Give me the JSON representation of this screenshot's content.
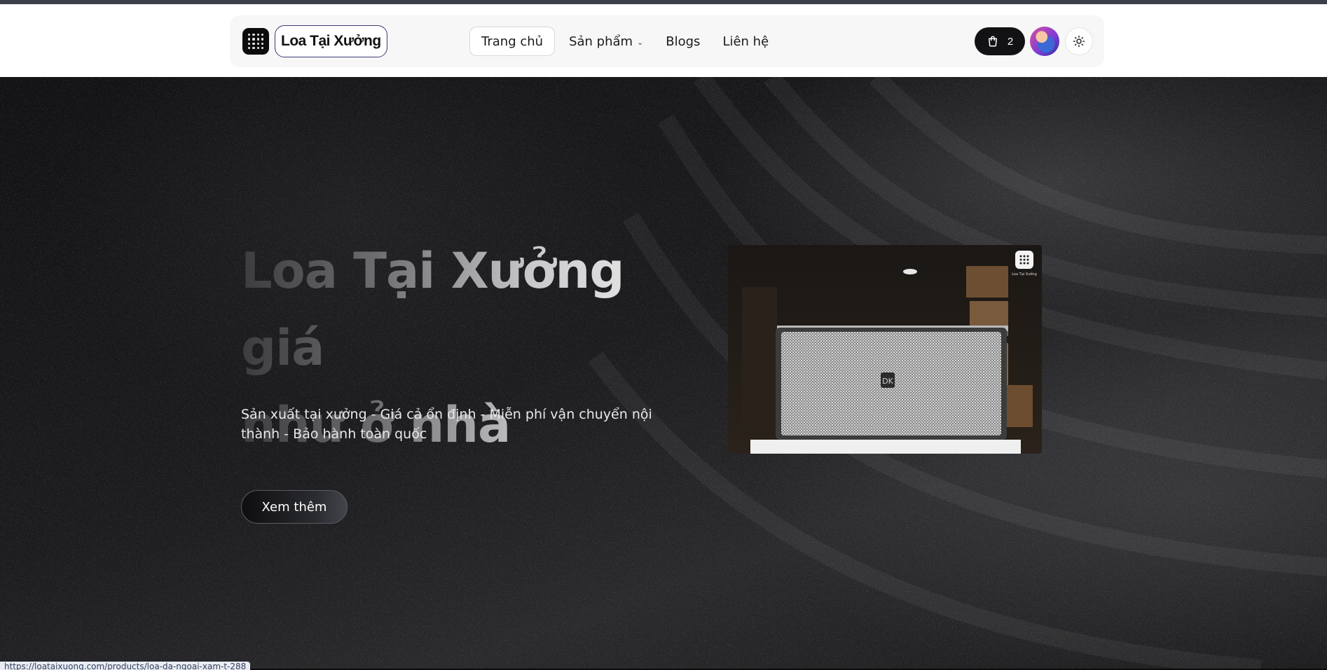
{
  "header": {
    "brand_name": "Loa Tại Xưởng",
    "nav": [
      {
        "label": "Trang chủ",
        "active": true
      },
      {
        "label": "Sản phẩm",
        "has_dropdown": true
      },
      {
        "label": "Blogs"
      },
      {
        "label": "Liên hệ"
      }
    ],
    "cart_count": "2",
    "icons": {
      "cart": "cart-icon",
      "theme": "sun-icon",
      "dropdown": "chevron-down-icon"
    }
  },
  "hero": {
    "title_line1": "Loa Tại Xưởng giá",
    "title_line2": "như ở nhà",
    "subtitle": "Sản xuất tại xưởng - Giá cả ổn định - Miễn phí vận chuyển nội thành - Bảo hành toàn quốc",
    "cta_label": "Xem thêm",
    "media_watermark": "Loa Tại Xưởng",
    "media_badge": "DK"
  },
  "status_bar": {
    "url": "https://loataixuong.com/products/loa-da-ngoai-xam-t-288"
  },
  "colors": {
    "brand_border": "#3b3b78",
    "cart_bg": "#121214",
    "hero_bg": "#1c1c1f"
  }
}
